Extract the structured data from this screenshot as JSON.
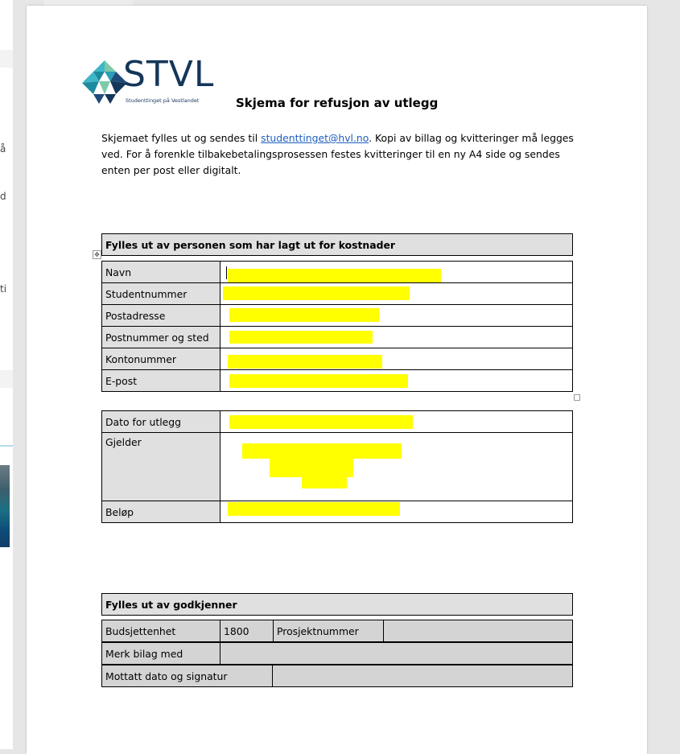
{
  "sidebar_fragments": [
    "å",
    "d",
    "ti"
  ],
  "logo": {
    "text": "STVL",
    "subtitle": "Studenttinget på Vestlandet",
    "colors": [
      "#1e8aa0",
      "#3fb7c7",
      "#7ec9a8",
      "#1f4b7a",
      "#14365a"
    ]
  },
  "document": {
    "title": "Skjema for refusjon av utlegg",
    "intro_before_link": "Skjemaet fylles ut og sendes til ",
    "intro_link": "studenttinget@hvl.no",
    "intro_after_link": ". Kopi av billag og kvitteringer må legges ved. For å forenkle tilbakebetalingsprosessen festes kvitteringer til en ny A4 side og sendes enten per post eller digitalt."
  },
  "person_section": {
    "header": "Fylles ut av personen som har lagt ut for kostnader",
    "rows": [
      {
        "label": "Navn",
        "value": ""
      },
      {
        "label": "Studentnummer",
        "value": ""
      },
      {
        "label": "Postadresse",
        "value": ""
      },
      {
        "label": "Postnummer og sted",
        "value": ""
      },
      {
        "label": "Kontonummer",
        "value": ""
      },
      {
        "label": "E-post",
        "value": ""
      }
    ]
  },
  "expense_section": {
    "rows": [
      {
        "label": "Dato for utlegg",
        "value": ""
      },
      {
        "label": "Gjelder",
        "value": ""
      },
      {
        "label": "Beløp",
        "value": ""
      }
    ]
  },
  "approver_section": {
    "header": "Fylles ut av godkjenner",
    "budget_label": "Budsjettenhet",
    "budget_value": "1800",
    "project_label": "Prosjektnummer",
    "project_value": "",
    "mark_label": "Merk bilag med",
    "mark_value": "",
    "received_label": "Mottatt dato og signatur",
    "received_value": ""
  },
  "highlight_color": "#ffff00"
}
